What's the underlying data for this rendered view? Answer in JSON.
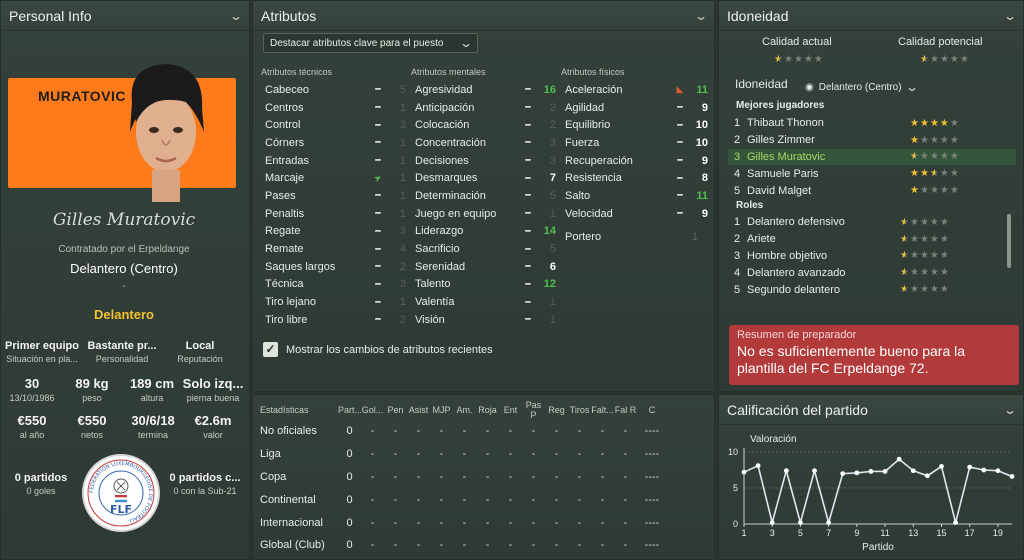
{
  "personal": {
    "title": "Personal Info",
    "banner_name": "MURATOVIC",
    "signature": "Gilles Muratovic",
    "contract": "Contratado por el Erpeldange",
    "position": "Delantero (Centro)",
    "dash": "-",
    "role": "Delantero",
    "stats": [
      {
        "value": "Primer equipo",
        "label": "Situación en pla..."
      },
      {
        "value": "Bastante pr...",
        "label": "Personalidad"
      },
      {
        "value": "Local",
        "label": "Reputación"
      },
      {
        "value": "30",
        "label": "13/10/1986"
      },
      {
        "value": "89 kg",
        "label": "peso"
      },
      {
        "value": "189 cm",
        "label": "altura"
      },
      {
        "value": "Solo izq...",
        "label": "pierna buena"
      },
      {
        "value": "€550",
        "label": "al año"
      },
      {
        "value": "€550",
        "label": "netos"
      },
      {
        "value": "30/6/18",
        "label": "termina"
      },
      {
        "value": "€2.6m",
        "label": "valor"
      },
      {
        "value": "0 partidos",
        "label": "0 goles"
      },
      {
        "value": "0 partidos c...",
        "label": "0 con la Sub-21"
      }
    ],
    "emblem_text": "FLF",
    "emblem_ring": "FEDERATION LUXEMBOURGEOISE DE FOOTBALL"
  },
  "attributes": {
    "title": "Atributos",
    "dropdown": "Destacar atributos clave para el puesto",
    "headers": [
      "Atributos técnicos",
      "Atributos mentales",
      "Atributos físicos"
    ],
    "technical": [
      {
        "name": "Cabeceo",
        "value": "5",
        "cls": "v-dim"
      },
      {
        "name": "Centros",
        "value": "1",
        "cls": "v-dim"
      },
      {
        "name": "Control",
        "value": "3",
        "cls": "v-dim"
      },
      {
        "name": "Córners",
        "value": "1",
        "cls": "v-dim"
      },
      {
        "name": "Entradas",
        "value": "1",
        "cls": "v-dim"
      },
      {
        "name": "Marcaje",
        "value": "1",
        "cls": "v-dim",
        "arrow": "up"
      },
      {
        "name": "Pases",
        "value": "1",
        "cls": "v-dim"
      },
      {
        "name": "Penaltis",
        "value": "1",
        "cls": "v-dim"
      },
      {
        "name": "Regate",
        "value": "3",
        "cls": "v-dim"
      },
      {
        "name": "Remate",
        "value": "4",
        "cls": "v-dim"
      },
      {
        "name": "Saques largos",
        "value": "2",
        "cls": "v-dim"
      },
      {
        "name": "Técnica",
        "value": "3",
        "cls": "v-dim"
      },
      {
        "name": "Tiro lejano",
        "value": "1",
        "cls": "v-dim"
      },
      {
        "name": "Tiro libre",
        "value": "2",
        "cls": "v-dim"
      }
    ],
    "mental": [
      {
        "name": "Agresividad",
        "value": "16",
        "cls": "v-green"
      },
      {
        "name": "Anticipación",
        "value": "2",
        "cls": "v-dim"
      },
      {
        "name": "Colocación",
        "value": "2",
        "cls": "v-dim"
      },
      {
        "name": "Concentración",
        "value": "3",
        "cls": "v-dim"
      },
      {
        "name": "Decisiones",
        "value": "3",
        "cls": "v-dim"
      },
      {
        "name": "Desmarques",
        "value": "7",
        "cls": "v-white"
      },
      {
        "name": "Determinación",
        "value": "5",
        "cls": "v-dim"
      },
      {
        "name": "Juego en equipo",
        "value": "1",
        "cls": "v-dim"
      },
      {
        "name": "Liderazgo",
        "value": "14",
        "cls": "v-green"
      },
      {
        "name": "Sacrificio",
        "value": "5",
        "cls": "v-dim"
      },
      {
        "name": "Serenidad",
        "value": "6",
        "cls": "v-white"
      },
      {
        "name": "Talento",
        "value": "12",
        "cls": "v-green"
      },
      {
        "name": "Valentía",
        "value": "1",
        "cls": "v-dim"
      },
      {
        "name": "Visión",
        "value": "1",
        "cls": "v-dim"
      }
    ],
    "physical": [
      {
        "name": "Aceleración",
        "value": "11",
        "cls": "v-green",
        "arrow": "down"
      },
      {
        "name": "Agilidad",
        "value": "9",
        "cls": "v-white"
      },
      {
        "name": "Equilibrio",
        "value": "10",
        "cls": "v-white"
      },
      {
        "name": "Fuerza",
        "value": "10",
        "cls": "v-white"
      },
      {
        "name": "Recuperación",
        "value": "9",
        "cls": "v-white"
      },
      {
        "name": "Resistencia",
        "value": "8",
        "cls": "v-white"
      },
      {
        "name": "Salto",
        "value": "11",
        "cls": "v-green"
      },
      {
        "name": "Velocidad",
        "value": "9",
        "cls": "v-white"
      }
    ],
    "goalkeeper": {
      "name": "Portero",
      "value": "1"
    },
    "checkbox_label": "Mostrar los cambios de atributos recientes"
  },
  "statistics": {
    "headers": [
      "Estadísticas",
      "Part...",
      "Gol...",
      "Pen",
      "Asist",
      "MJP",
      "Am.",
      "Roja",
      "Ent",
      "Pas P",
      "Reg",
      "Tiros",
      "Falt...",
      "Fal R",
      "C"
    ],
    "rows": [
      [
        "No oficiales",
        "0",
        "-",
        "-",
        "-",
        "-",
        "-",
        "-",
        "-",
        "-",
        "-",
        "-",
        "-",
        "-",
        "----"
      ],
      [
        "Liga",
        "0",
        "-",
        "-",
        "-",
        "-",
        "-",
        "-",
        "-",
        "-",
        "-",
        "-",
        "-",
        "-",
        "----"
      ],
      [
        "Copa",
        "0",
        "-",
        "-",
        "-",
        "-",
        "-",
        "-",
        "-",
        "-",
        "-",
        "-",
        "-",
        "-",
        "----"
      ],
      [
        "Continental",
        "0",
        "-",
        "-",
        "-",
        "-",
        "-",
        "-",
        "-",
        "-",
        "-",
        "-",
        "-",
        "-",
        "----"
      ],
      [
        "Internacional",
        "0",
        "-",
        "-",
        "-",
        "-",
        "-",
        "-",
        "-",
        "-",
        "-",
        "-",
        "-",
        "-",
        "----"
      ],
      [
        "Global (Club)",
        "0",
        "-",
        "-",
        "-",
        "-",
        "-",
        "-",
        "-",
        "-",
        "-",
        "-",
        "-",
        "-",
        "----"
      ]
    ]
  },
  "suitability": {
    "title": "Idoneidad",
    "current_label": "Calidad actual",
    "potential_label": "Calidad potencial",
    "current_stars": 0.5,
    "potential_stars": 0.5,
    "section_label": "Idoneidad",
    "position_select": "Delantero (Centro)",
    "best_label": "Mejores jugadores",
    "best": [
      {
        "num": "1",
        "name": "Thibaut Thonon",
        "stars": 4,
        "highlight": false
      },
      {
        "num": "2",
        "name": "Gilles Zimmer",
        "stars": 1,
        "highlight": false
      },
      {
        "num": "3",
        "name": "Gilles Muratovic",
        "stars": 0.5,
        "highlight": true
      },
      {
        "num": "4",
        "name": "Samuele Paris",
        "stars": 2.5,
        "highlight": false
      },
      {
        "num": "5",
        "name": "David Malget",
        "stars": 1,
        "highlight": false
      }
    ],
    "roles_label": "Roles",
    "roles": [
      {
        "num": "1",
        "name": "Delantero defensivo",
        "stars": 0.5
      },
      {
        "num": "2",
        "name": "Ariete",
        "stars": 0.5
      },
      {
        "num": "3",
        "name": "Hombre objetivo",
        "stars": 0.5
      },
      {
        "num": "4",
        "name": "Delantero avanzado",
        "stars": 0.5
      },
      {
        "num": "5",
        "name": "Segundo delantero",
        "stars": 0.5
      }
    ],
    "coach_title": "Resumen de preparador",
    "coach_text": "No es suficientemente bueno para la plantilla del FC Erpeldange 72."
  },
  "match_rating": {
    "title": "Calificación del partido",
    "colors": {
      "line": "#dfe7ef",
      "axis": "#c9d1cb"
    }
  },
  "chart_data": {
    "type": "line",
    "ylabel": "Valoración",
    "xlabel": "Partido",
    "ylim": [
      0,
      10
    ],
    "yticks": [
      0,
      5,
      10
    ],
    "xticks": [
      1,
      3,
      5,
      7,
      9,
      11,
      13,
      15,
      17,
      19
    ],
    "x": [
      1,
      2,
      3,
      4,
      5,
      6,
      7,
      8,
      9,
      10,
      11,
      12,
      13,
      14,
      15,
      16,
      17,
      18,
      19,
      20
    ],
    "series": [
      {
        "values": [
          7.2,
          8.1,
          0.2,
          7.4,
          0.2,
          7.4,
          0.2,
          7.0,
          7.1,
          7.3,
          7.3,
          9.0,
          7.4,
          6.7,
          8.0,
          0.2,
          7.9,
          7.5,
          7.4,
          6.6
        ]
      }
    ]
  }
}
